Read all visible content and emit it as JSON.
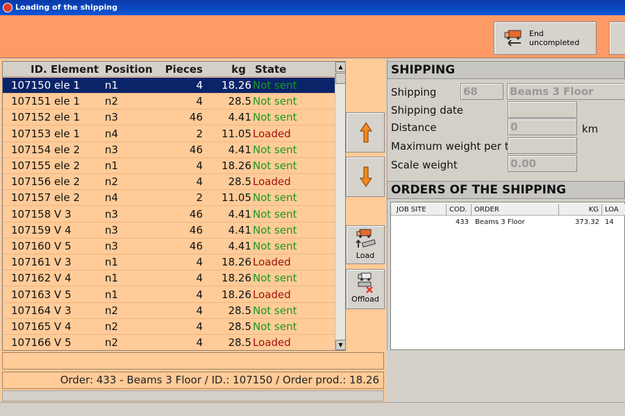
{
  "window": {
    "title": "Loading of the shipping"
  },
  "toolbar": {
    "end_uncompleted_label": "End uncompleted"
  },
  "table": {
    "headers": {
      "id": "ID.",
      "element": "Element",
      "position": "Position",
      "pieces": "Pieces",
      "kg": "kg",
      "state": "State"
    },
    "rows": [
      {
        "id": "107150",
        "element": "ele 1",
        "position": "n1",
        "pieces": "4",
        "kg": "18.26",
        "state": "Not sent"
      },
      {
        "id": "107151",
        "element": "ele 1",
        "position": "n2",
        "pieces": "4",
        "kg": "28.5",
        "state": "Not sent"
      },
      {
        "id": "107152",
        "element": "ele 1",
        "position": "n3",
        "pieces": "46",
        "kg": "4.41",
        "state": "Not sent"
      },
      {
        "id": "107153",
        "element": "ele 1",
        "position": "n4",
        "pieces": "2",
        "kg": "11.05",
        "state": "Loaded"
      },
      {
        "id": "107154",
        "element": "ele 2",
        "position": "n3",
        "pieces": "46",
        "kg": "4.41",
        "state": "Not sent"
      },
      {
        "id": "107155",
        "element": "ele 2",
        "position": "n1",
        "pieces": "4",
        "kg": "18.26",
        "state": "Not sent"
      },
      {
        "id": "107156",
        "element": "ele 2",
        "position": "n2",
        "pieces": "4",
        "kg": "28.5",
        "state": "Loaded"
      },
      {
        "id": "107157",
        "element": "ele 2",
        "position": "n4",
        "pieces": "2",
        "kg": "11.05",
        "state": "Not sent"
      },
      {
        "id": "107158",
        "element": "V 3",
        "position": "n3",
        "pieces": "46",
        "kg": "4.41",
        "state": "Not sent"
      },
      {
        "id": "107159",
        "element": "V 4",
        "position": "n3",
        "pieces": "46",
        "kg": "4.41",
        "state": "Not sent"
      },
      {
        "id": "107160",
        "element": "V 5",
        "position": "n3",
        "pieces": "46",
        "kg": "4.41",
        "state": "Not sent"
      },
      {
        "id": "107161",
        "element": "V 3",
        "position": "n1",
        "pieces": "4",
        "kg": "18.26",
        "state": "Loaded"
      },
      {
        "id": "107162",
        "element": "V 4",
        "position": "n1",
        "pieces": "4",
        "kg": "18.26",
        "state": "Not sent"
      },
      {
        "id": "107163",
        "element": "V 5",
        "position": "n1",
        "pieces": "4",
        "kg": "18.26",
        "state": "Loaded"
      },
      {
        "id": "107164",
        "element": "V 3",
        "position": "n2",
        "pieces": "4",
        "kg": "28.5",
        "state": "Not sent"
      },
      {
        "id": "107165",
        "element": "V 4",
        "position": "n2",
        "pieces": "4",
        "kg": "28.5",
        "state": "Not sent"
      },
      {
        "id": "107166",
        "element": "V 5",
        "position": "n2",
        "pieces": "4",
        "kg": "28.5",
        "state": "Loaded"
      }
    ]
  },
  "side_buttons": {
    "load_label": "Load",
    "offload_label": "Offload"
  },
  "status": {
    "summary": "Order: 433 - Beams 3 Floor / ID.: 107150 / Order prod.: 18.26"
  },
  "shipping": {
    "section_title": "SHIPPING",
    "shipping_label": "Shipping",
    "shipping_id": "68",
    "shipping_name": "Beams 3 Floor",
    "date_label": "Shipping date",
    "date_value": "",
    "distance_label": "Distance",
    "distance_value": "0",
    "distance_unit": "km",
    "max_weight_label": "Maximum weight per tru",
    "max_weight_value": "",
    "scale_weight_label": "Scale weight",
    "scale_weight_value": "0.00"
  },
  "orders": {
    "section_title": "ORDERS OF THE SHIPPING",
    "headers": {
      "job_site": "JOB SITE",
      "cod": "COD.",
      "order": "ORDER",
      "kg": "KG",
      "loaded": "LOA"
    },
    "rows": [
      {
        "job_site": "",
        "cod": "433",
        "order": "Beams 3 Floor",
        "kg": "373.32",
        "loaded": "14"
      }
    ]
  },
  "colors": {
    "accent": "#ff9a66",
    "panel": "#ffcb98",
    "selection": "#0a246a",
    "not_sent": "#1a9a1a",
    "loaded": "#a01010"
  }
}
